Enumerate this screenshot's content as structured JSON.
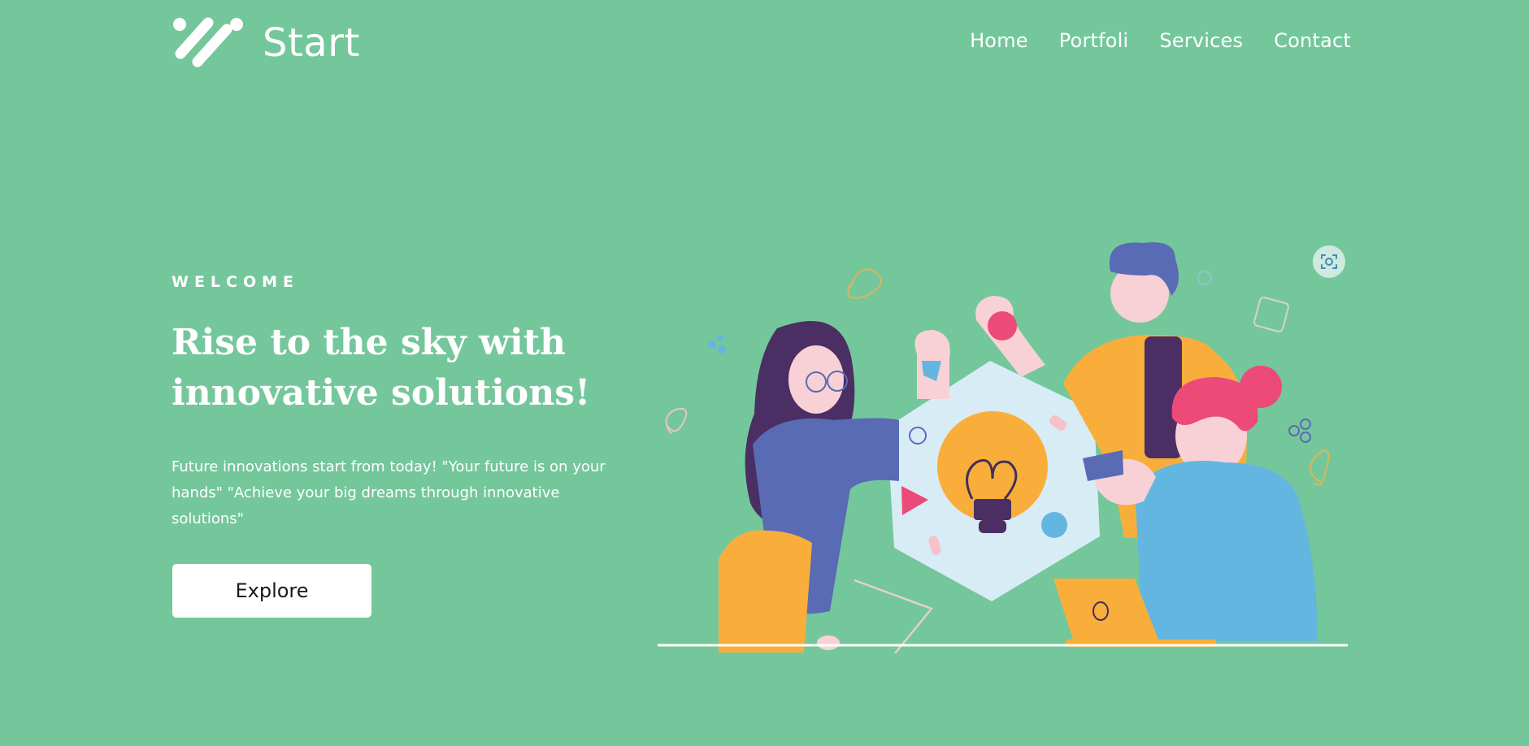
{
  "header": {
    "logo_text": "Start",
    "nav": [
      {
        "label": "Home"
      },
      {
        "label": "Portfoli"
      },
      {
        "label": "Services"
      },
      {
        "label": "Contact"
      }
    ]
  },
  "hero": {
    "eyebrow": "WELCOME",
    "title": "Rise to the sky with innovative solutions!",
    "subtitle": "Future innovations start from today! \"Your future is on your hands\" \"Achieve your big dreams through innovative solutions\"",
    "cta_label": "Explore"
  },
  "illustration": {
    "icon": "team-brainstorm-illustration"
  },
  "image_action": {
    "icon": "scan-icon"
  },
  "colors": {
    "background": "#74c79b",
    "text": "#ffffff",
    "button_bg": "#ffffff",
    "button_text": "#1a1a1a",
    "accent_yellow": "#f9ae3b",
    "accent_blue": "#5a6bb5",
    "accent_pink": "#ec4a78",
    "accent_sky": "#63b6df"
  }
}
